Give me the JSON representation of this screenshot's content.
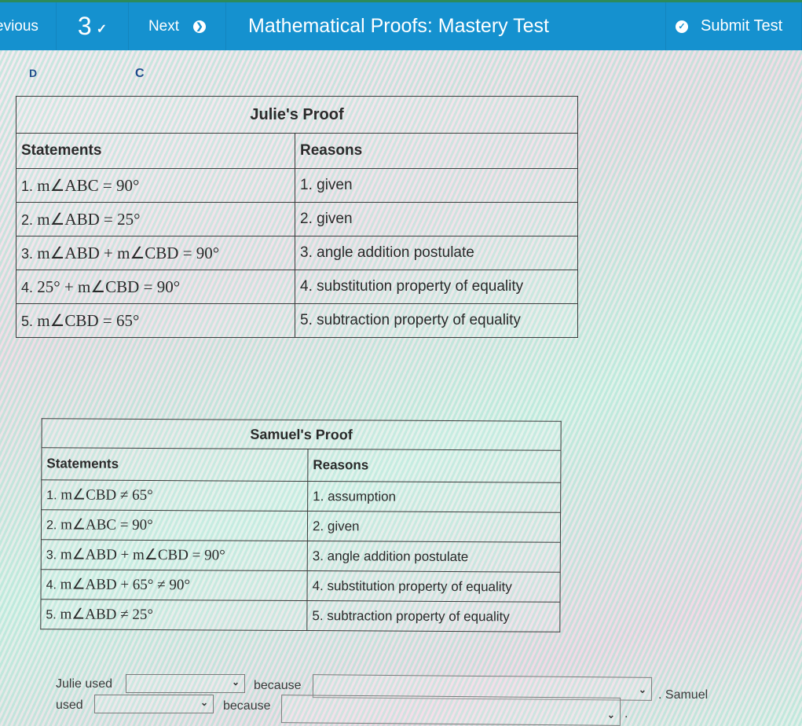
{
  "header": {
    "previous_label": "evious",
    "question_number": "3",
    "next_label": "Next",
    "title": "Mathematical Proofs: Mastery Test",
    "submit_label": "Submit Test"
  },
  "stray_marks": [
    "D",
    "C"
  ],
  "julie_proof": {
    "caption": "Julie's Proof",
    "col_statements": "Statements",
    "col_reasons": "Reasons",
    "rows": [
      {
        "num": "1.",
        "statement": "m∠ABC = 90°",
        "reason": "1. given"
      },
      {
        "num": "2.",
        "statement": "m∠ABD = 25°",
        "reason": "2. given"
      },
      {
        "num": "3.",
        "statement": "m∠ABD + m∠CBD = 90°",
        "reason": "3. angle addition postulate"
      },
      {
        "num": "4.",
        "statement": "25° + m∠CBD = 90°",
        "reason": "4. substitution property of equality"
      },
      {
        "num": "5.",
        "statement": "m∠CBD = 65°",
        "reason": "5. subtraction property of equality"
      }
    ]
  },
  "samuel_proof": {
    "caption": "Samuel's Proof",
    "col_statements": "Statements",
    "col_reasons": "Reasons",
    "rows": [
      {
        "num": "1.",
        "statement": "m∠CBD ≠ 65°",
        "reason": "1. assumption"
      },
      {
        "num": "2.",
        "statement": "m∠ABC = 90°",
        "reason": "2. given"
      },
      {
        "num": "3.",
        "statement": "m∠ABD + m∠CBD = 90°",
        "reason": "3. angle addition postulate"
      },
      {
        "num": "4.",
        "statement": "m∠ABD + 65° ≠ 90°",
        "reason": "4. substitution property of equality"
      },
      {
        "num": "5.",
        "statement": "m∠ABD ≠ 25°",
        "reason": "5. subtraction property of equality"
      }
    ]
  },
  "answer": {
    "julie_used": "Julie used",
    "because_1": "because",
    "samuel_suffix": ". Samuel",
    "used": "used",
    "because_2": "because",
    "period": ".",
    "select_julie_method": "",
    "select_julie_reason": "",
    "select_samuel_method": "",
    "select_samuel_reason": ""
  }
}
